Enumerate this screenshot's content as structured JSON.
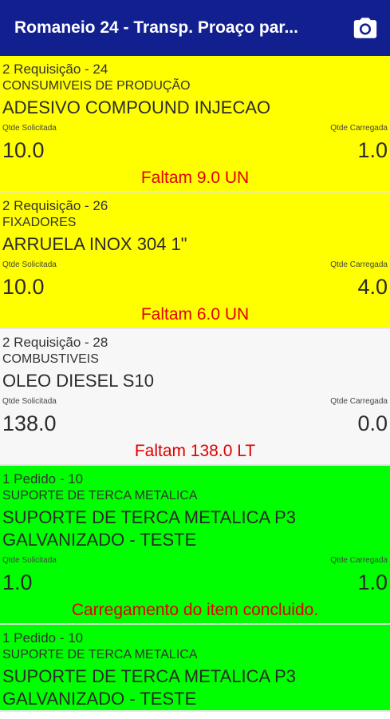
{
  "app_bar": {
    "title": "Romaneio 24  - Transp. Proaço par...",
    "camera_icon": "camera-icon"
  },
  "items": [
    {
      "header": "2 Requisição - 24",
      "group": "CONSUMIVEIS DE PRODUÇÃO",
      "product": "ADESIVO COMPOUND INJECAO",
      "label_solicitada": "Qtde Solicitada",
      "label_carregada": "Qtde Carregada",
      "qtde_solicitada": "10.0",
      "qtde_carregada": "1.0",
      "status": "Faltam 9.0 UN",
      "color": "#ffff00"
    },
    {
      "header": "2 Requisição - 26",
      "group": "FIXADORES",
      "product": "ARRUELA INOX 304 1\"",
      "label_solicitada": "Qtde Solicitada",
      "label_carregada": "Qtde Carregada",
      "qtde_solicitada": "10.0",
      "qtde_carregada": "4.0",
      "status": "Faltam 6.0 UN",
      "color": "#ffff00"
    },
    {
      "header": "2 Requisição - 28",
      "group": "COMBUSTIVEIS",
      "product": "OLEO DIESEL S10",
      "label_solicitada": "Qtde Solicitada",
      "label_carregada": "Qtde Carregada",
      "qtde_solicitada": "138.0",
      "qtde_carregada": "0.0",
      "status": "Faltam 138.0 LT",
      "color": "#f7f7f7"
    },
    {
      "header": "1 Pedido - 10",
      "group": "SUPORTE DE TERCA METALICA",
      "product": "SUPORTE DE TERCA METALICA P3 GALVANIZADO - TESTE",
      "label_solicitada": "Qtde Solicitada",
      "label_carregada": "Qtde Carregada",
      "qtde_solicitada": "1.0",
      "qtde_carregada": "1.0",
      "status": "Carregamento do item concluido.",
      "color": "#00ff00"
    },
    {
      "header": "1 Pedido - 10",
      "group": "SUPORTE DE TERCA METALICA",
      "product": "SUPORTE DE TERCA METALICA P3 GALVANIZADO - TESTE",
      "color": "#00ff00"
    }
  ]
}
